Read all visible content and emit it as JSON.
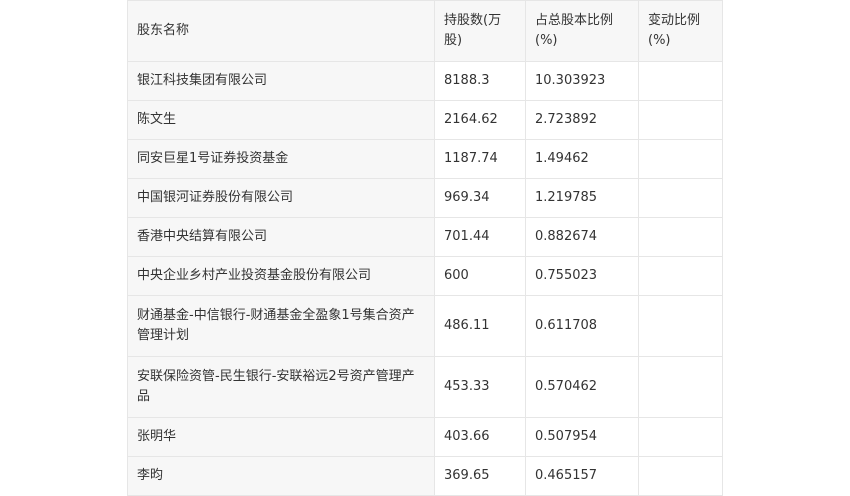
{
  "table": {
    "headers": [
      "股东名称",
      "持股数(万股)",
      "占总股本比例(%)",
      "变动比例(%)"
    ],
    "rows": [
      {
        "name": "银江科技集团有限公司",
        "shares": "8188.3",
        "ratio": "10.303923",
        "change": ""
      },
      {
        "name": "陈文生",
        "shares": "2164.62",
        "ratio": "2.723892",
        "change": ""
      },
      {
        "name": "同安巨星1号证券投资基金",
        "shares": "1187.74",
        "ratio": "1.49462",
        "change": ""
      },
      {
        "name": "中国银河证券股份有限公司",
        "shares": "969.34",
        "ratio": "1.219785",
        "change": ""
      },
      {
        "name": "香港中央结算有限公司",
        "shares": "701.44",
        "ratio": "0.882674",
        "change": ""
      },
      {
        "name": "中央企业乡村产业投资基金股份有限公司",
        "shares": "600",
        "ratio": "0.755023",
        "change": ""
      },
      {
        "name": "财通基金-中信银行-财通基金全盈象1号集合资产管理计划",
        "shares": "486.11",
        "ratio": "0.611708",
        "change": ""
      },
      {
        "name": "安联保险资管-民生银行-安联裕远2号资产管理产品",
        "shares": "453.33",
        "ratio": "0.570462",
        "change": ""
      },
      {
        "name": "张明华",
        "shares": "403.66",
        "ratio": "0.507954",
        "change": ""
      },
      {
        "name": "李昀",
        "shares": "369.65",
        "ratio": "0.465157",
        "change": ""
      }
    ]
  }
}
